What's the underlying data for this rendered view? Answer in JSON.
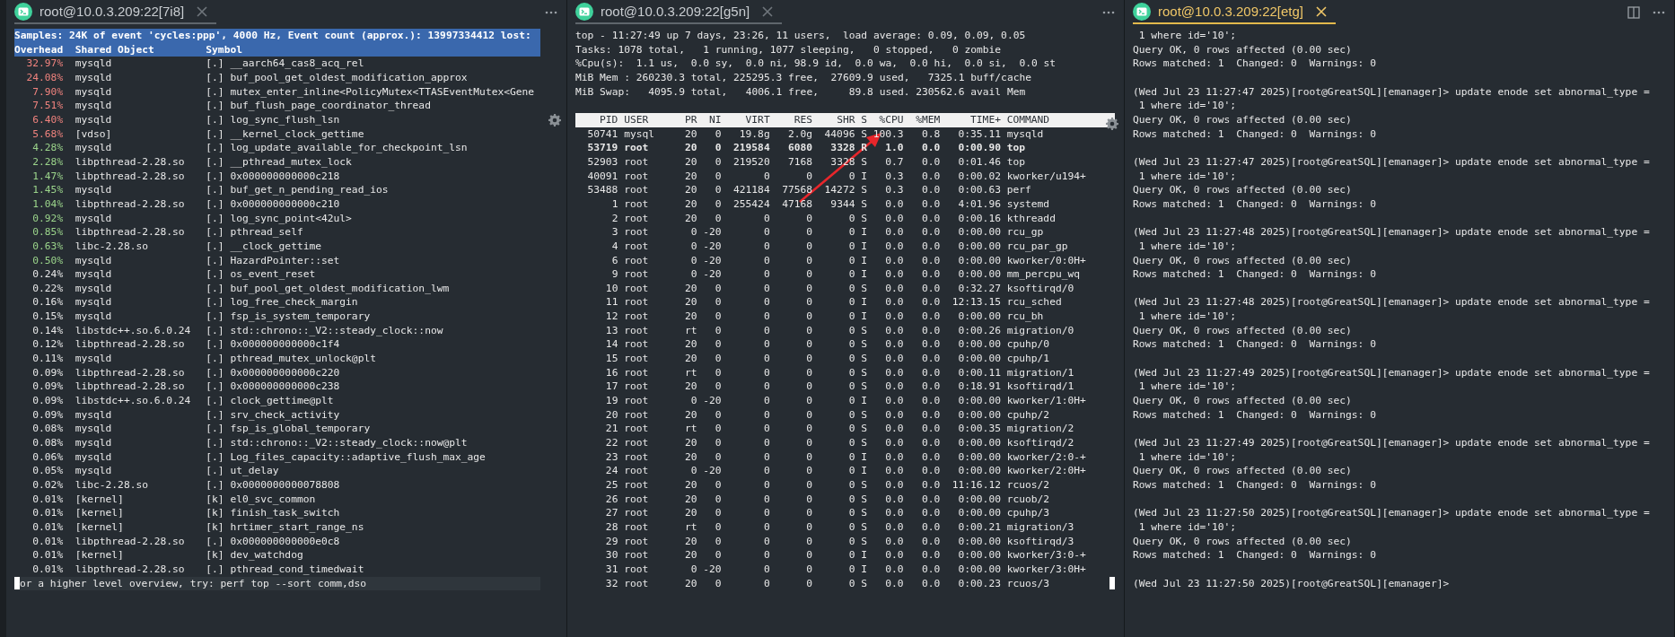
{
  "panes": [
    {
      "kind": "perf",
      "tab": {
        "title": "root@10.0.3.209:22[7i8]",
        "selected": false
      },
      "banner": "Samples: 24K of event 'cycles:ppp', 4000 Hz, Event count (approx.): 13997334412 lost:",
      "columns": [
        "Overhead",
        "Shared Object",
        "Symbol"
      ],
      "rows": [
        {
          "overhead": "32.97%",
          "color": "#f0837e",
          "object": "mysqld",
          "tag": "[.]",
          "symbol": "__aarch64_cas8_acq_rel"
        },
        {
          "overhead": "24.08%",
          "color": "#f0837e",
          "object": "mysqld",
          "tag": "[.]",
          "symbol": "buf_pool_get_oldest_modification_approx"
        },
        {
          "overhead": "7.90%",
          "color": "#f0837e",
          "object": "mysqld",
          "tag": "[.]",
          "symbol": "mutex_enter_inline<PolicyMutex<TTASEventMutex<Gene"
        },
        {
          "overhead": "7.51%",
          "color": "#f0837e",
          "object": "mysqld",
          "tag": "[.]",
          "symbol": "buf_flush_page_coordinator_thread"
        },
        {
          "overhead": "6.40%",
          "color": "#f0837e",
          "object": "mysqld",
          "tag": "[.]",
          "symbol": "log_sync_flush_lsn"
        },
        {
          "overhead": "5.68%",
          "color": "#f0837e",
          "object": "[vdso]",
          "tag": "[.]",
          "symbol": "__kernel_clock_gettime"
        },
        {
          "overhead": "4.28%",
          "color": "#9bd48b",
          "object": "mysqld",
          "tag": "[.]",
          "symbol": "log_update_available_for_checkpoint_lsn"
        },
        {
          "overhead": "2.28%",
          "color": "#9bd48b",
          "object": "libpthread-2.28.so",
          "tag": "[.]",
          "symbol": "__pthread_mutex_lock"
        },
        {
          "overhead": "1.47%",
          "color": "#9bd48b",
          "object": "libpthread-2.28.so",
          "tag": "[.]",
          "symbol": "0x000000000000c218"
        },
        {
          "overhead": "1.45%",
          "color": "#9bd48b",
          "object": "mysqld",
          "tag": "[.]",
          "symbol": "buf_get_n_pending_read_ios"
        },
        {
          "overhead": "1.04%",
          "color": "#9bd48b",
          "object": "libpthread-2.28.so",
          "tag": "[.]",
          "symbol": "0x000000000000c210"
        },
        {
          "overhead": "0.92%",
          "color": "#9bd48b",
          "object": "mysqld",
          "tag": "[.]",
          "symbol": "log_sync_point<42ul>"
        },
        {
          "overhead": "0.85%",
          "color": "#9bd48b",
          "object": "libpthread-2.28.so",
          "tag": "[.]",
          "symbol": "pthread_self"
        },
        {
          "overhead": "0.63%",
          "color": "#9bd48b",
          "object": "libc-2.28.so",
          "tag": "[.]",
          "symbol": "__clock_gettime"
        },
        {
          "overhead": "0.50%",
          "color": "#9bd48b",
          "object": "mysqld",
          "tag": "[.]",
          "symbol": "HazardPointer::set"
        },
        {
          "overhead": "0.24%",
          "color": "#e8e8e8",
          "object": "mysqld",
          "tag": "[.]",
          "symbol": "os_event_reset"
        },
        {
          "overhead": "0.22%",
          "color": "#e8e8e8",
          "object": "mysqld",
          "tag": "[.]",
          "symbol": "buf_pool_get_oldest_modification_lwm"
        },
        {
          "overhead": "0.16%",
          "color": "#e8e8e8",
          "object": "mysqld",
          "tag": "[.]",
          "symbol": "log_free_check_margin"
        },
        {
          "overhead": "0.15%",
          "color": "#e8e8e8",
          "object": "mysqld",
          "tag": "[.]",
          "symbol": "fsp_is_system_temporary"
        },
        {
          "overhead": "0.14%",
          "color": "#e8e8e8",
          "object": "libstdc++.so.6.0.24",
          "tag": "[.]",
          "symbol": "std::chrono::_V2::steady_clock::now"
        },
        {
          "overhead": "0.12%",
          "color": "#e8e8e8",
          "object": "libpthread-2.28.so",
          "tag": "[.]",
          "symbol": "0x000000000000c1f4"
        },
        {
          "overhead": "0.11%",
          "color": "#e8e8e8",
          "object": "mysqld",
          "tag": "[.]",
          "symbol": "pthread_mutex_unlock@plt"
        },
        {
          "overhead": "0.09%",
          "color": "#e8e8e8",
          "object": "libpthread-2.28.so",
          "tag": "[.]",
          "symbol": "0x000000000000c220"
        },
        {
          "overhead": "0.09%",
          "color": "#e8e8e8",
          "object": "libpthread-2.28.so",
          "tag": "[.]",
          "symbol": "0x000000000000c238"
        },
        {
          "overhead": "0.09%",
          "color": "#e8e8e8",
          "object": "libstdc++.so.6.0.24",
          "tag": "[.]",
          "symbol": "clock_gettime@plt"
        },
        {
          "overhead": "0.09%",
          "color": "#e8e8e8",
          "object": "mysqld",
          "tag": "[.]",
          "symbol": "srv_check_activity"
        },
        {
          "overhead": "0.08%",
          "color": "#e8e8e8",
          "object": "mysqld",
          "tag": "[.]",
          "symbol": "fsp_is_global_temporary"
        },
        {
          "overhead": "0.08%",
          "color": "#e8e8e8",
          "object": "mysqld",
          "tag": "[.]",
          "symbol": "std::chrono::_V2::steady_clock::now@plt"
        },
        {
          "overhead": "0.06%",
          "color": "#e8e8e8",
          "object": "mysqld",
          "tag": "[.]",
          "symbol": "Log_files_capacity::adaptive_flush_max_age"
        },
        {
          "overhead": "0.05%",
          "color": "#e8e8e8",
          "object": "mysqld",
          "tag": "[.]",
          "symbol": "ut_delay"
        },
        {
          "overhead": "0.02%",
          "color": "#e8e8e8",
          "object": "libc-2.28.so",
          "tag": "[.]",
          "symbol": "0x0000000000078808"
        },
        {
          "overhead": "0.01%",
          "color": "#e8e8e8",
          "object": "[kernel]",
          "tag": "[k]",
          "symbol": "el0_svc_common"
        },
        {
          "overhead": "0.01%",
          "color": "#e8e8e8",
          "object": "[kernel]",
          "tag": "[k]",
          "symbol": "finish_task_switch"
        },
        {
          "overhead": "0.01%",
          "color": "#e8e8e8",
          "object": "[kernel]",
          "tag": "[k]",
          "symbol": "hrtimer_start_range_ns"
        },
        {
          "overhead": "0.01%",
          "color": "#e8e8e8",
          "object": "libpthread-2.28.so",
          "tag": "[.]",
          "symbol": "0x000000000000e0c8"
        },
        {
          "overhead": "0.01%",
          "color": "#e8e8e8",
          "object": "[kernel]",
          "tag": "[k]",
          "symbol": "dev_watchdog"
        },
        {
          "overhead": "0.01%",
          "color": "#e8e8e8",
          "object": "libpthread-2.28.so",
          "tag": "[.]",
          "symbol": "pthread_cond_timedwait"
        }
      ],
      "footer": "or a higher level overview, try: perf top --sort comm,dso"
    },
    {
      "kind": "top",
      "tab": {
        "title": "root@10.0.3.209:22[g5n]",
        "selected": false
      },
      "summary": [
        "top - 11:27:49 up 7 days, 23:26, 11 users,  load average: 0.09, 0.09, 0.05",
        "Tasks: 1078 total,   1 running, 1077 sleeping,   0 stopped,   0 zombie",
        "%Cpu(s):  1.1 us,  0.0 sy,  0.0 ni, 98.9 id,  0.0 wa,  0.0 hi,  0.0 si,  0.0 st",
        "MiB Mem : 260230.3 total, 225295.3 free,  27609.9 used,   7325.1 buff/cache",
        "MiB Swap:   4095.9 total,   4006.1 free,     89.8 used. 230562.6 avail Mem"
      ],
      "columns": [
        "PID",
        "USER",
        "PR",
        "NI",
        "VIRT",
        "RES",
        "SHR",
        "S",
        "%CPU",
        "%MEM",
        "TIME+",
        "COMMAND"
      ],
      "rows": [
        {
          "highlighted": false,
          "cells": [
            "50741",
            "mysql",
            "20",
            "0",
            "19.8g",
            "2.0g",
            "44096",
            "S",
            "100.3",
            "0.8",
            "0:35.11",
            "mysqld"
          ]
        },
        {
          "highlighted": true,
          "cells": [
            "53719",
            "root",
            "20",
            "0",
            "219584",
            "6080",
            "3328",
            "R",
            "1.0",
            "0.0",
            "0:00.90",
            "top"
          ]
        },
        {
          "highlighted": false,
          "cells": [
            "52903",
            "root",
            "20",
            "0",
            "219520",
            "7168",
            "3328",
            "S",
            "0.7",
            "0.0",
            "0:01.46",
            "top"
          ]
        },
        {
          "highlighted": false,
          "cells": [
            "40091",
            "root",
            "20",
            "0",
            "0",
            "0",
            "0",
            "I",
            "0.3",
            "0.0",
            "0:00.02",
            "kworker/u194+"
          ]
        },
        {
          "highlighted": false,
          "cells": [
            "53488",
            "root",
            "20",
            "0",
            "421184",
            "77568",
            "14272",
            "S",
            "0.3",
            "0.0",
            "0:00.63",
            "perf"
          ]
        },
        {
          "highlighted": false,
          "cells": [
            "1",
            "root",
            "20",
            "0",
            "255424",
            "47168",
            "9344",
            "S",
            "0.0",
            "0.0",
            "4:01.96",
            "systemd"
          ]
        },
        {
          "highlighted": false,
          "cells": [
            "2",
            "root",
            "20",
            "0",
            "0",
            "0",
            "0",
            "S",
            "0.0",
            "0.0",
            "0:00.16",
            "kthreadd"
          ]
        },
        {
          "highlighted": false,
          "cells": [
            "3",
            "root",
            "0",
            "-20",
            "0",
            "0",
            "0",
            "I",
            "0.0",
            "0.0",
            "0:00.00",
            "rcu_gp"
          ]
        },
        {
          "highlighted": false,
          "cells": [
            "4",
            "root",
            "0",
            "-20",
            "0",
            "0",
            "0",
            "I",
            "0.0",
            "0.0",
            "0:00.00",
            "rcu_par_gp"
          ]
        },
        {
          "highlighted": false,
          "cells": [
            "6",
            "root",
            "0",
            "-20",
            "0",
            "0",
            "0",
            "I",
            "0.0",
            "0.0",
            "0:00.00",
            "kworker/0:0H+"
          ]
        },
        {
          "highlighted": false,
          "cells": [
            "9",
            "root",
            "0",
            "-20",
            "0",
            "0",
            "0",
            "I",
            "0.0",
            "0.0",
            "0:00.00",
            "mm_percpu_wq"
          ]
        },
        {
          "highlighted": false,
          "cells": [
            "10",
            "root",
            "20",
            "0",
            "0",
            "0",
            "0",
            "S",
            "0.0",
            "0.0",
            "0:32.27",
            "ksoftirqd/0"
          ]
        },
        {
          "highlighted": false,
          "cells": [
            "11",
            "root",
            "20",
            "0",
            "0",
            "0",
            "0",
            "I",
            "0.0",
            "0.0",
            "12:13.15",
            "rcu_sched"
          ]
        },
        {
          "highlighted": false,
          "cells": [
            "12",
            "root",
            "20",
            "0",
            "0",
            "0",
            "0",
            "I",
            "0.0",
            "0.0",
            "0:00.00",
            "rcu_bh"
          ]
        },
        {
          "highlighted": false,
          "cells": [
            "13",
            "root",
            "rt",
            "0",
            "0",
            "0",
            "0",
            "S",
            "0.0",
            "0.0",
            "0:00.26",
            "migration/0"
          ]
        },
        {
          "highlighted": false,
          "cells": [
            "14",
            "root",
            "20",
            "0",
            "0",
            "0",
            "0",
            "S",
            "0.0",
            "0.0",
            "0:00.00",
            "cpuhp/0"
          ]
        },
        {
          "highlighted": false,
          "cells": [
            "15",
            "root",
            "20",
            "0",
            "0",
            "0",
            "0",
            "S",
            "0.0",
            "0.0",
            "0:00.00",
            "cpuhp/1"
          ]
        },
        {
          "highlighted": false,
          "cells": [
            "16",
            "root",
            "rt",
            "0",
            "0",
            "0",
            "0",
            "S",
            "0.0",
            "0.0",
            "0:00.11",
            "migration/1"
          ]
        },
        {
          "highlighted": false,
          "cells": [
            "17",
            "root",
            "20",
            "0",
            "0",
            "0",
            "0",
            "S",
            "0.0",
            "0.0",
            "0:18.91",
            "ksoftirqd/1"
          ]
        },
        {
          "highlighted": false,
          "cells": [
            "19",
            "root",
            "0",
            "-20",
            "0",
            "0",
            "0",
            "I",
            "0.0",
            "0.0",
            "0:00.00",
            "kworker/1:0H+"
          ]
        },
        {
          "highlighted": false,
          "cells": [
            "20",
            "root",
            "20",
            "0",
            "0",
            "0",
            "0",
            "S",
            "0.0",
            "0.0",
            "0:00.00",
            "cpuhp/2"
          ]
        },
        {
          "highlighted": false,
          "cells": [
            "21",
            "root",
            "rt",
            "0",
            "0",
            "0",
            "0",
            "S",
            "0.0",
            "0.0",
            "0:00.35",
            "migration/2"
          ]
        },
        {
          "highlighted": false,
          "cells": [
            "22",
            "root",
            "20",
            "0",
            "0",
            "0",
            "0",
            "S",
            "0.0",
            "0.0",
            "0:00.00",
            "ksoftirqd/2"
          ]
        },
        {
          "highlighted": false,
          "cells": [
            "23",
            "root",
            "20",
            "0",
            "0",
            "0",
            "0",
            "I",
            "0.0",
            "0.0",
            "0:00.00",
            "kworker/2:0-+"
          ]
        },
        {
          "highlighted": false,
          "cells": [
            "24",
            "root",
            "0",
            "-20",
            "0",
            "0",
            "0",
            "I",
            "0.0",
            "0.0",
            "0:00.00",
            "kworker/2:0H+"
          ]
        },
        {
          "highlighted": false,
          "cells": [
            "25",
            "root",
            "20",
            "0",
            "0",
            "0",
            "0",
            "S",
            "0.0",
            "0.0",
            "11:16.12",
            "rcuos/2"
          ]
        },
        {
          "highlighted": false,
          "cells": [
            "26",
            "root",
            "20",
            "0",
            "0",
            "0",
            "0",
            "S",
            "0.0",
            "0.0",
            "0:00.00",
            "rcuob/2"
          ]
        },
        {
          "highlighted": false,
          "cells": [
            "27",
            "root",
            "20",
            "0",
            "0",
            "0",
            "0",
            "S",
            "0.0",
            "0.0",
            "0:00.00",
            "cpuhp/3"
          ]
        },
        {
          "highlighted": false,
          "cells": [
            "28",
            "root",
            "rt",
            "0",
            "0",
            "0",
            "0",
            "S",
            "0.0",
            "0.0",
            "0:00.21",
            "migration/3"
          ]
        },
        {
          "highlighted": false,
          "cells": [
            "29",
            "root",
            "20",
            "0",
            "0",
            "0",
            "0",
            "S",
            "0.0",
            "0.0",
            "0:00.00",
            "ksoftirqd/3"
          ]
        },
        {
          "highlighted": false,
          "cells": [
            "30",
            "root",
            "20",
            "0",
            "0",
            "0",
            "0",
            "I",
            "0.0",
            "0.0",
            "0:00.00",
            "kworker/3:0-+"
          ]
        },
        {
          "highlighted": false,
          "cells": [
            "31",
            "root",
            "0",
            "-20",
            "0",
            "0",
            "0",
            "I",
            "0.0",
            "0.0",
            "0:00.00",
            "kworker/3:0H+"
          ]
        },
        {
          "highlighted": false,
          "cells": [
            "32",
            "root",
            "20",
            "0",
            "0",
            "0",
            "0",
            "S",
            "0.0",
            "0.0",
            "0:00.23",
            "rcuos/3"
          ]
        }
      ]
    },
    {
      "kind": "mysql",
      "tab": {
        "title": "root@10.0.3.209:22[etg]",
        "selected": true
      },
      "blocks": [
        {
          "output": [
            " 1 where id='10';",
            "Query OK, 0 rows affected (0.00 sec)",
            "Rows matched: 1  Changed: 0  Warnings: 0"
          ]
        },
        {
          "prompt": "(Wed Jul 23 11:27:47 2025)[root@GreatSQL][emanager]> update enode set abnormal_type =",
          "output": [
            " 1 where id='10';",
            "Query OK, 0 rows affected (0.00 sec)",
            "Rows matched: 1  Changed: 0  Warnings: 0"
          ]
        },
        {
          "prompt": "(Wed Jul 23 11:27:47 2025)[root@GreatSQL][emanager]> update enode set abnormal_type =",
          "output": [
            " 1 where id='10';",
            "Query OK, 0 rows affected (0.00 sec)",
            "Rows matched: 1  Changed: 0  Warnings: 0"
          ]
        },
        {
          "prompt": "(Wed Jul 23 11:27:48 2025)[root@GreatSQL][emanager]> update enode set abnormal_type =",
          "output": [
            " 1 where id='10';",
            "Query OK, 0 rows affected (0.00 sec)",
            "Rows matched: 1  Changed: 0  Warnings: 0"
          ]
        },
        {
          "prompt": "(Wed Jul 23 11:27:48 2025)[root@GreatSQL][emanager]> update enode set abnormal_type =",
          "output": [
            " 1 where id='10';",
            "Query OK, 0 rows affected (0.00 sec)",
            "Rows matched: 1  Changed: 0  Warnings: 0"
          ]
        },
        {
          "prompt": "(Wed Jul 23 11:27:49 2025)[root@GreatSQL][emanager]> update enode set abnormal_type =",
          "output": [
            " 1 where id='10';",
            "Query OK, 0 rows affected (0.00 sec)",
            "Rows matched: 1  Changed: 0  Warnings: 0"
          ]
        },
        {
          "prompt": "(Wed Jul 23 11:27:49 2025)[root@GreatSQL][emanager]> update enode set abnormal_type =",
          "output": [
            " 1 where id='10';",
            "Query OK, 0 rows affected (0.00 sec)",
            "Rows matched: 1  Changed: 0  Warnings: 0"
          ]
        },
        {
          "prompt": "(Wed Jul 23 11:27:50 2025)[root@GreatSQL][emanager]> update enode set abnormal_type =",
          "output": [
            " 1 where id='10';",
            "Query OK, 0 rows affected (0.00 sec)",
            "Rows matched: 1  Changed: 0  Warnings: 0"
          ]
        },
        {
          "prompt": "(Wed Jul 23 11:27:50 2025)[root@GreatSQL][emanager]>"
        }
      ]
    }
  ]
}
